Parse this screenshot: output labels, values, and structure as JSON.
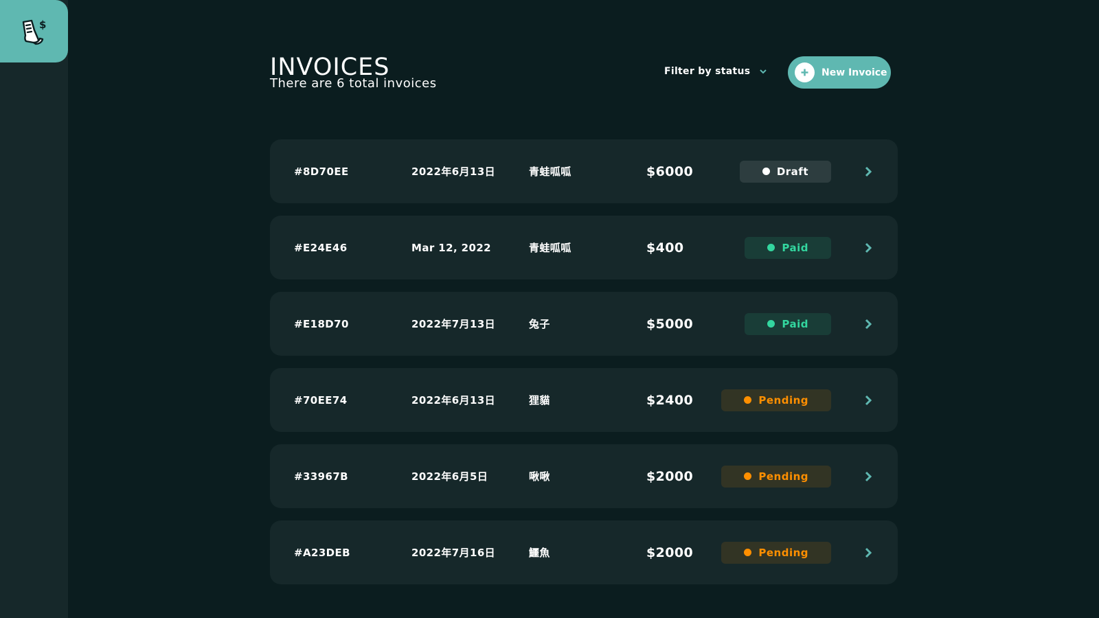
{
  "header": {
    "title": "INVOICES",
    "subtitle": "There are 6 total invoices",
    "filter_label": "Filter by status",
    "new_invoice_label": "New Invoice"
  },
  "colors": {
    "accent": "#5fb8b1",
    "background": "#0b1d1f",
    "card": "#16282a",
    "draft": "#ffffff",
    "paid": "#33d69f",
    "pending": "#ff8f00"
  },
  "invoices": [
    {
      "id": "#8D70EE",
      "date": "2022年6月13日",
      "client": "青蛙呱呱",
      "amount": "$6000",
      "status": "Draft"
    },
    {
      "id": "#E24E46",
      "date": "Mar 12, 2022",
      "client": "青蛙呱呱",
      "amount": "$400",
      "status": "Paid"
    },
    {
      "id": "#E18D70",
      "date": "2022年7月13日",
      "client": "兔子",
      "amount": "$5000",
      "status": "Paid"
    },
    {
      "id": "#70EE74",
      "date": "2022年6月13日",
      "client": "狸貓",
      "amount": "$2400",
      "status": "Pending"
    },
    {
      "id": "#33967B",
      "date": "2022年6月5日",
      "client": "啾啾",
      "amount": "$2000",
      "status": "Pending"
    },
    {
      "id": "#A23DEB",
      "date": "2022年7月16日",
      "client": "鱷魚",
      "amount": "$2000",
      "status": "Pending"
    }
  ],
  "icons": {
    "logo": "receipt-dollar-icon",
    "filter_chevron": "chevron-down-icon",
    "new_invoice": "plus-icon",
    "row_arrow": "chevron-right-icon"
  }
}
